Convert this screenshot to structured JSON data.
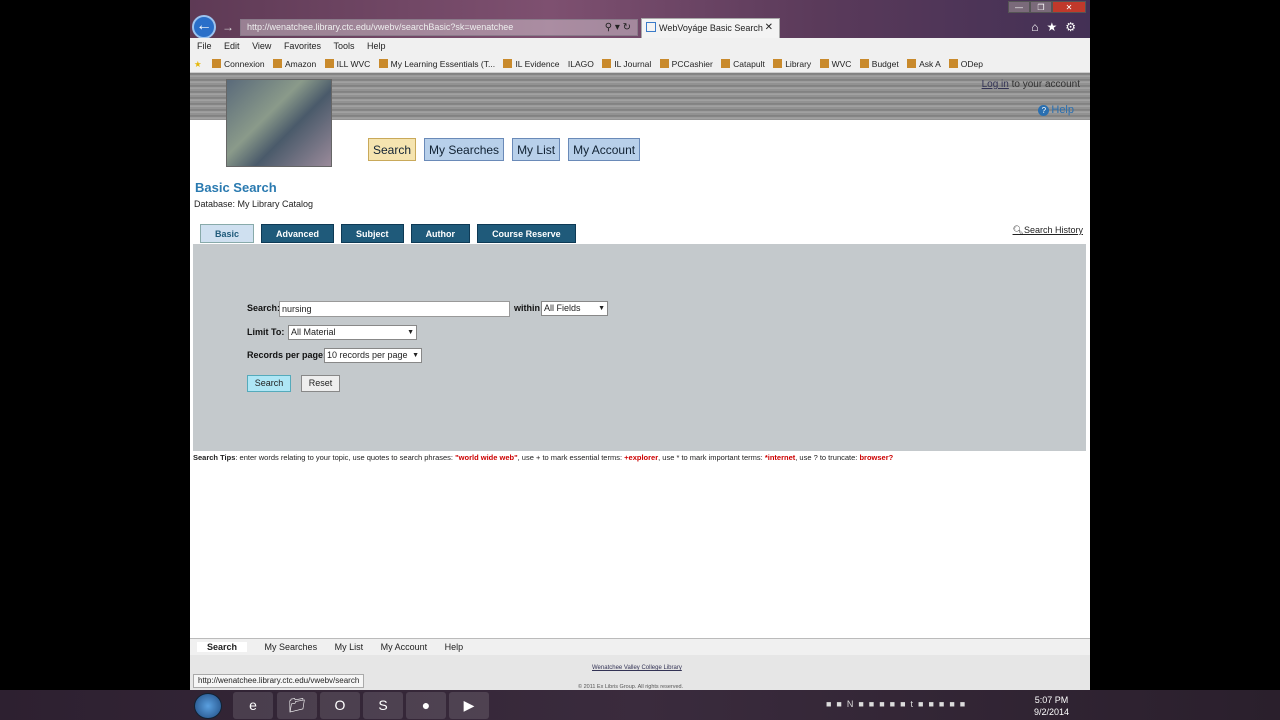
{
  "browser": {
    "address": "http://wenatchee.library.ctc.edu/vwebv/searchBasic?sk=wenatchee",
    "tab_title": "WebVoyáge Basic Search",
    "menu": [
      "File",
      "Edit",
      "View",
      "Favorites",
      "Tools",
      "Help"
    ],
    "favorites": [
      "Connexion",
      "Amazon",
      "ILL WVC",
      "My Learning Essentials (T...",
      "IL Evidence",
      "ILAGO",
      "IL Journal",
      "PCCashier",
      "Catapult",
      "Library",
      "WVC",
      "Budget",
      "Ask A",
      "ODep"
    ]
  },
  "header": {
    "login_link": "Log in",
    "login_suffix": " to your account",
    "help": "Help"
  },
  "mainnav": [
    "Search",
    "My Searches",
    "My List",
    "My Account"
  ],
  "page": {
    "title": "Basic Search",
    "database": "Database: My Library Catalog",
    "search_history": "Search History"
  },
  "search_tabs": [
    "Basic",
    "Advanced",
    "Subject",
    "Author",
    "Course Reserve"
  ],
  "form": {
    "search_label": "Search:",
    "search_value": "nursing",
    "within_label": "within",
    "within_value": "All Fields",
    "limit_label": "Limit To:",
    "limit_value": "All Material",
    "records_label": "Records per page:",
    "records_value": "10 records per page",
    "search_button": "Search",
    "reset_button": "Reset"
  },
  "tips": {
    "label": "Search Tips",
    "t1": ": enter words relating to your topic, use quotes to search phrases: ",
    "e1": "\"world wide web\"",
    "t2": ", use + to mark essential terms: ",
    "e2": "+explorer",
    "t3": ", use * to mark important terms: ",
    "e3": "*internet",
    "t4": ", use ? to truncate: ",
    "e4": "browser?"
  },
  "footnav": [
    "Search",
    "My Searches",
    "My List",
    "My Account",
    "Help"
  ],
  "footer": {
    "library": "Wenatchee Valley College Library",
    "copyright": "© 2011 Ex Libris Group. All rights reserved."
  },
  "status_url": "http://wenatchee.library.ctc.edu/vwebv/search",
  "clock": {
    "time": "5:07 PM",
    "date": "9/2/2014"
  }
}
